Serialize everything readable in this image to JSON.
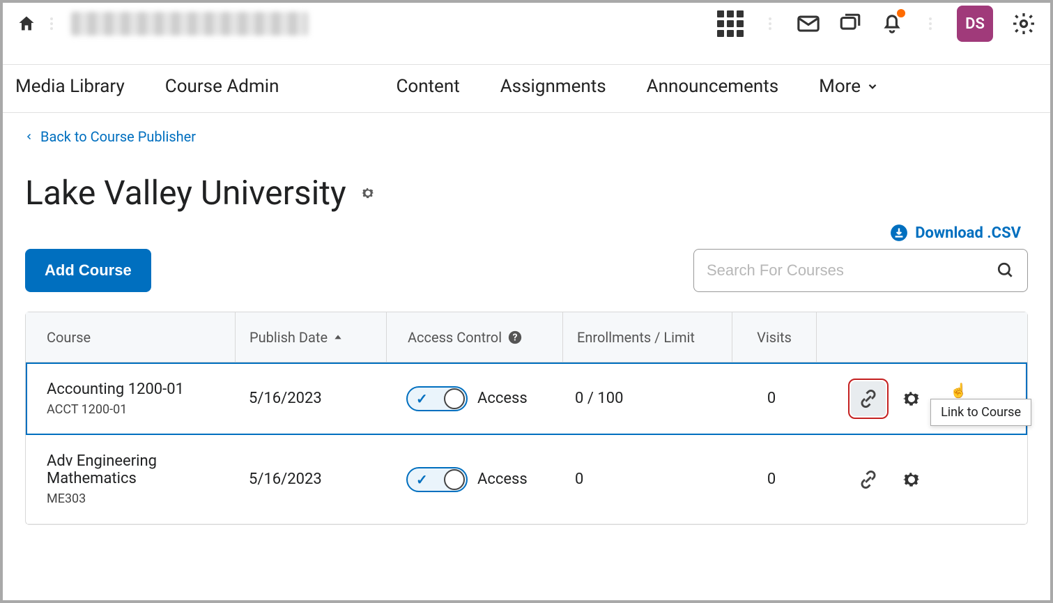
{
  "header": {
    "user_initials": "DS"
  },
  "nav": {
    "items": [
      "Media Library",
      "Course Admin",
      "Content",
      "Assignments",
      "Announcements",
      "More"
    ]
  },
  "back_link": "Back to Course Publisher",
  "title": "Lake Valley University",
  "download_csv": "Download .CSV",
  "add_course": "Add Course",
  "search_placeholder": "Search For Courses",
  "table": {
    "headers": {
      "course": "Course",
      "publish": "Publish Date",
      "access": "Access Control",
      "enroll": "Enrollments / Limit",
      "visits": "Visits"
    },
    "rows": [
      {
        "name": "Accounting 1200-01",
        "code": "ACCT 1200-01",
        "publish_date": "5/16/2023",
        "access_label": "Access",
        "enrollment": "0 / 100",
        "visits": "0"
      },
      {
        "name": "Adv Engineering Mathematics",
        "code": "ME303",
        "publish_date": "5/16/2023",
        "access_label": "Access",
        "enrollment": "0",
        "visits": "0"
      }
    ]
  },
  "tooltip": "Link to Course"
}
